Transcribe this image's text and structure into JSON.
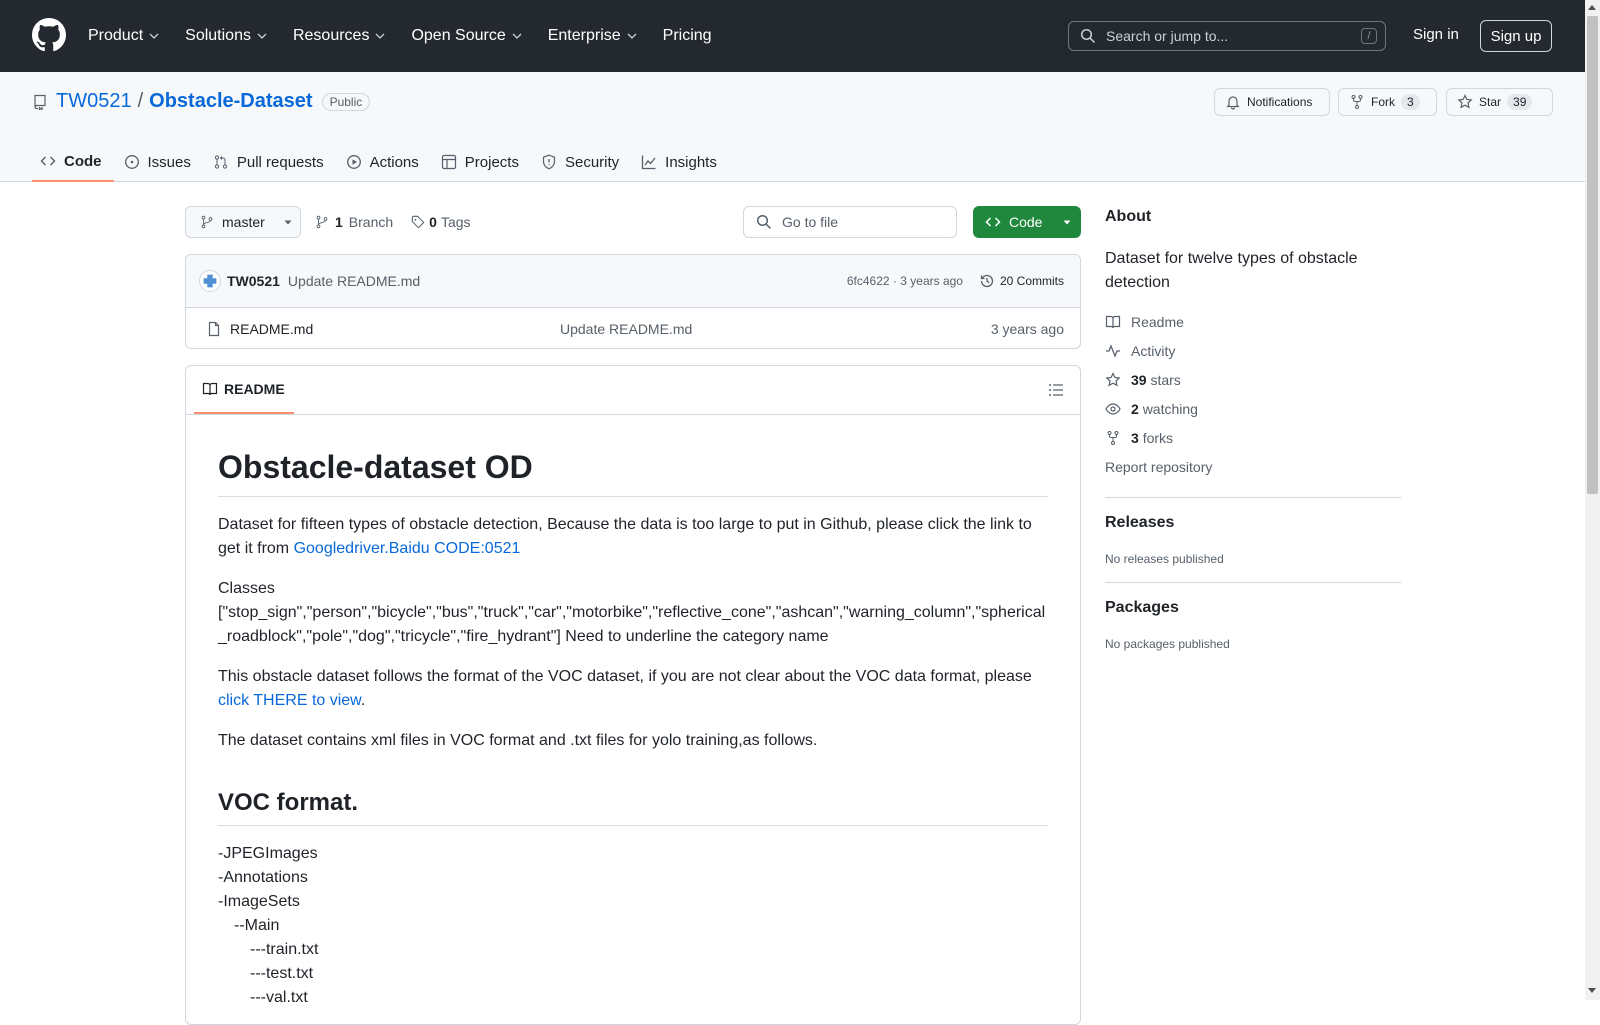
{
  "nav": {
    "items": [
      "Product",
      "Solutions",
      "Resources",
      "Open Source",
      "Enterprise",
      "Pricing"
    ],
    "search_placeholder": "Search or jump to...",
    "search_shortcut": "/",
    "sign_in": "Sign in",
    "sign_up": "Sign up"
  },
  "repo": {
    "owner": "TW0521",
    "separator": "/",
    "name": "Obstacle-Dataset",
    "visibility": "Public",
    "notifications_label": "Notifications",
    "fork_label": "Fork",
    "fork_count": "3",
    "star_label": "Star",
    "star_count": "39",
    "tabs": [
      "Code",
      "Issues",
      "Pull requests",
      "Actions",
      "Projects",
      "Security",
      "Insights"
    ]
  },
  "toolbar": {
    "branch": "master",
    "branch_count": "1",
    "branch_label": "Branch",
    "tag_count": "0",
    "tag_label": "Tags",
    "goto_placeholder": "Go to file",
    "code_label": "Code"
  },
  "commit": {
    "author": "TW0521",
    "message": "Update README.md",
    "hash": "6fc4622",
    "dot": "·",
    "age": "3 years ago",
    "commits_label": "20 Commits"
  },
  "files": [
    {
      "name": "README.md",
      "message": "Update README.md",
      "age": "3 years ago"
    }
  ],
  "readme": {
    "tab_label": "README",
    "title": "Obstacle-dataset OD",
    "p1_text": "Dataset for fifteen types of obstacle detection, Because the data is too large to put in Github, please click the link to get it from ",
    "link_google": "Googledriver",
    "link_sep": ".",
    "link_baidu": "Baidu CODE:0521",
    "classes_heading": "Classes",
    "classes_list": "[\"stop_sign\",\"person\",\"bicycle\",\"bus\",\"truck\",\"car\",\"motorbike\",\"reflective_cone\",\"ashcan\",\"warning_column\",\"spherical_roadblock\",\"pole\",\"dog\",\"tricycle\",\"fire_hydrant\"] Need to underline the category name",
    "p3_text": "This obstacle dataset follows the format of the VOC dataset, if you are not clear about the VOC data format, please ",
    "p3_link": "click THERE to view",
    "p3_end": ".",
    "p4": "The dataset contains xml files in VOC format and .txt files for yolo training,as follows.",
    "h2": "VOC format.",
    "tree": [
      "-JPEGImages",
      "-Annotations",
      "-ImageSets",
      "--Main",
      "---train.txt",
      "---test.txt",
      "---val.txt"
    ]
  },
  "about": {
    "heading": "About",
    "description": "Dataset for twelve types of obstacle detection",
    "readme_link": "Readme",
    "activity_link": "Activity",
    "stars_count": "39",
    "stars_label": "stars",
    "watching_count": "2",
    "watching_label": "watching",
    "forks_count": "3",
    "forks_label": "forks",
    "report": "Report repository"
  },
  "releases": {
    "heading": "Releases",
    "empty": "No releases published"
  },
  "packages": {
    "heading": "Packages",
    "empty": "No packages published"
  },
  "colors": {
    "header_bg": "#24292f",
    "link": "#0969da",
    "code_button": "#1f883d",
    "tab_underline": "#fd8c73"
  }
}
